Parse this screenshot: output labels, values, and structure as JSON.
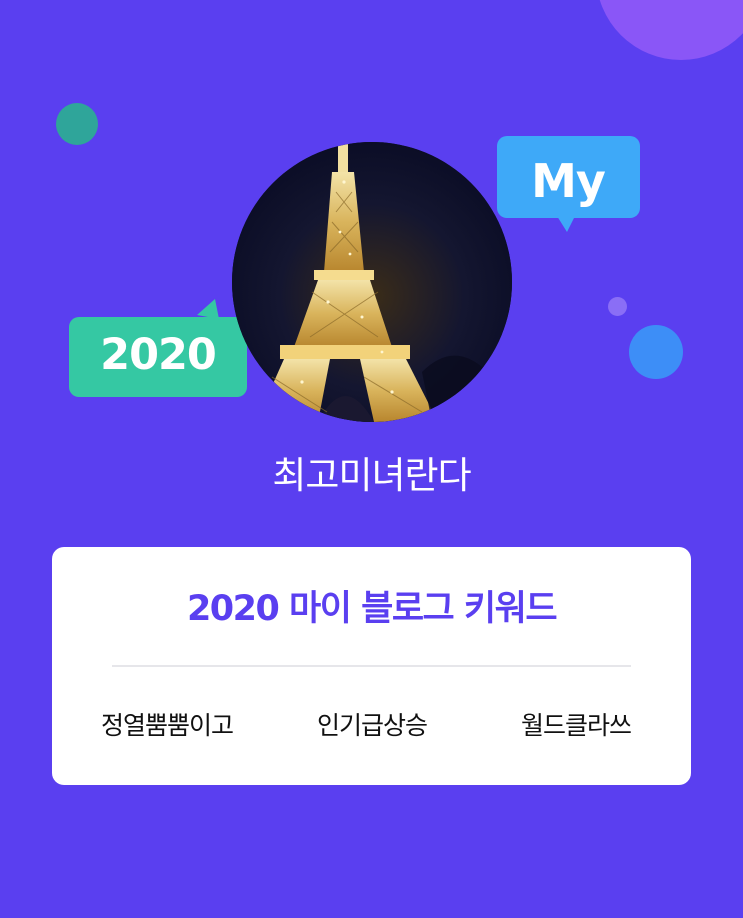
{
  "profile": {
    "username": "최고미녀란다",
    "avatar_subject": "eiffel-tower-at-night"
  },
  "bubbles": {
    "my_label": "My",
    "year_label": "2020"
  },
  "card": {
    "title": "2020 마이 블로그 키워드",
    "keywords": [
      "정열뿜뿜이고",
      "인기급상승",
      "월드클라쓰"
    ]
  },
  "colors": {
    "background": "#5a3ff0",
    "title_accent": "#5a3ff0",
    "bubble_my": "#3ea9f8",
    "bubble_2020": "#35c8a3",
    "circle_teal": "#2fa59a",
    "circle_blue": "#3d8ef7",
    "circle_purple": "#8a56f7",
    "card_background": "#ffffff"
  }
}
